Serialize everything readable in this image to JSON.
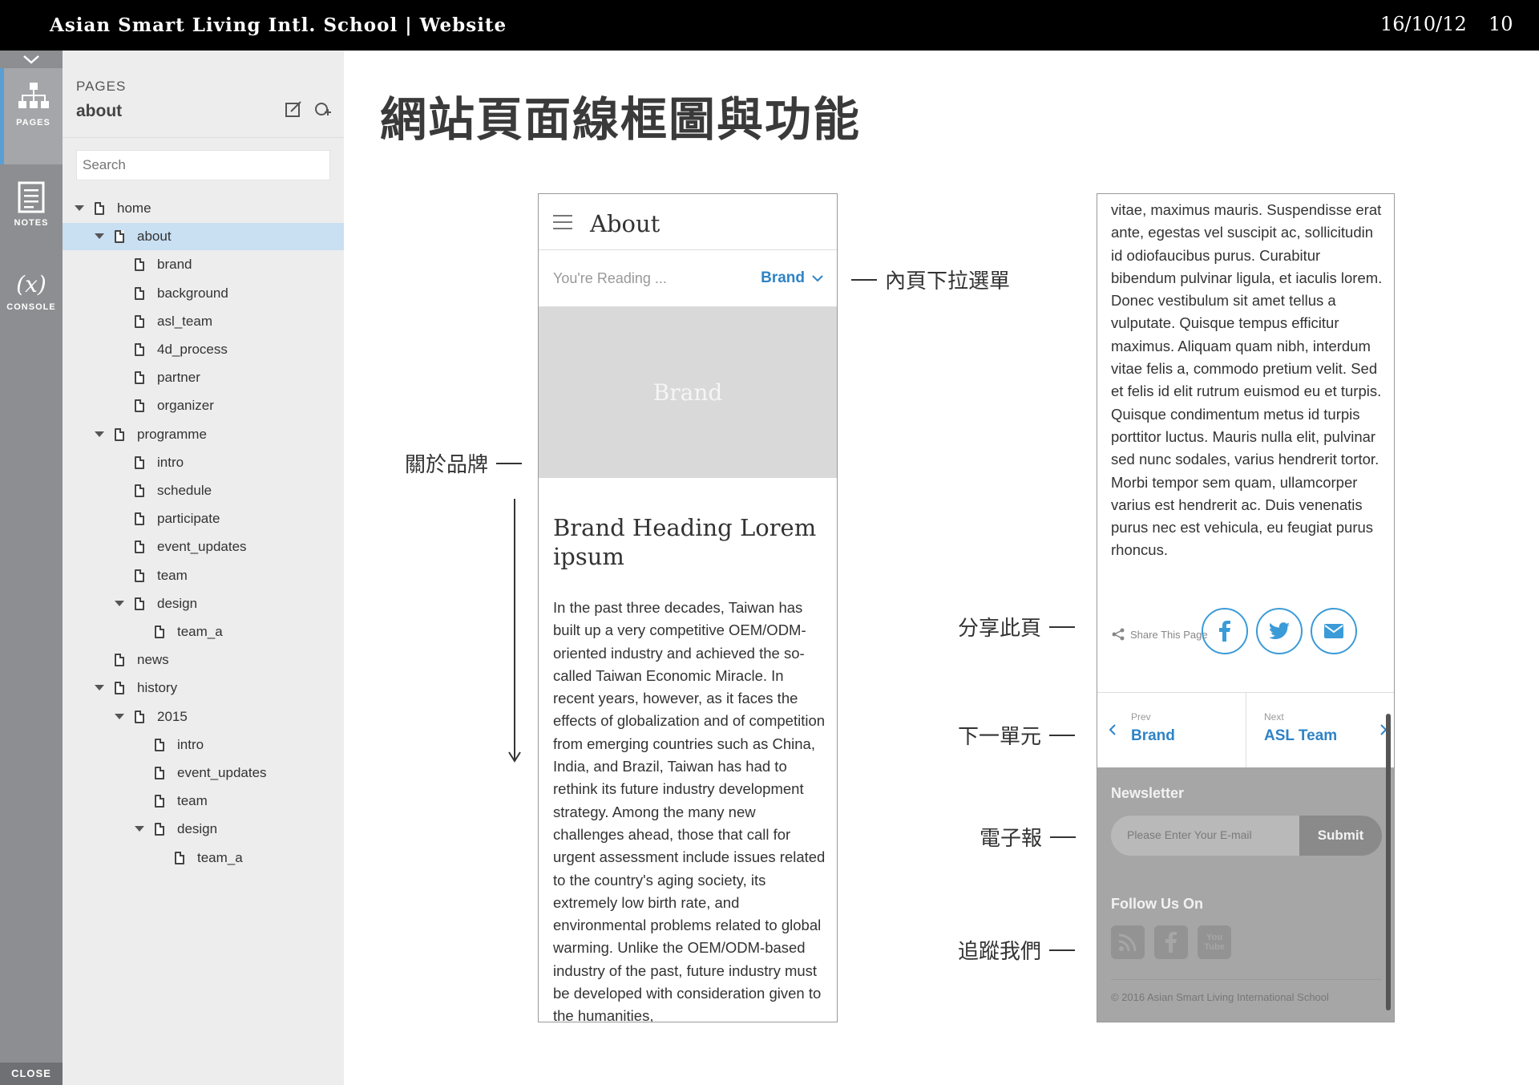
{
  "topbar": {
    "brand": "Asian Smart Living Intl. School | Website",
    "date": "16/10/12",
    "page_number": "10"
  },
  "rail": {
    "pages_label": "PAGES",
    "notes_label": "NOTES",
    "console_label": "CONSOLE",
    "console_symbol": "(x)",
    "close_label": "CLOSE"
  },
  "panel": {
    "heading": "PAGES",
    "current_page": "about",
    "search_placeholder": "Search",
    "tree": [
      {
        "label": "home",
        "depth": 0,
        "expanded": true,
        "selected": false
      },
      {
        "label": "about",
        "depth": 1,
        "expanded": true,
        "selected": true
      },
      {
        "label": "brand",
        "depth": 2
      },
      {
        "label": "background",
        "depth": 2
      },
      {
        "label": "asl_team",
        "depth": 2
      },
      {
        "label": "4d_process",
        "depth": 2
      },
      {
        "label": "partner",
        "depth": 2
      },
      {
        "label": "organizer",
        "depth": 2
      },
      {
        "label": "programme",
        "depth": 1,
        "expanded": true
      },
      {
        "label": "intro",
        "depth": 2
      },
      {
        "label": "schedule",
        "depth": 2
      },
      {
        "label": "participate",
        "depth": 2
      },
      {
        "label": "event_updates",
        "depth": 2
      },
      {
        "label": "team",
        "depth": 2
      },
      {
        "label": "design",
        "depth": 2,
        "expanded": true
      },
      {
        "label": "team_a",
        "depth": 3
      },
      {
        "label": "news",
        "depth": 1
      },
      {
        "label": "history",
        "depth": 1,
        "expanded": true
      },
      {
        "label": "2015",
        "depth": 2,
        "expanded": true
      },
      {
        "label": "intro",
        "depth": 3
      },
      {
        "label": "event_updates",
        "depth": 3
      },
      {
        "label": "team",
        "depth": 3
      },
      {
        "label": "design",
        "depth": 3,
        "expanded": true
      },
      {
        "label": "team_a",
        "depth": 4
      }
    ]
  },
  "slide": {
    "title": "網站頁面線框圖與功能",
    "annotations": {
      "dropdown": "內頁下拉選單",
      "brand": "關於品牌",
      "share": "分享此頁",
      "next_unit": "下一單元",
      "newsletter": "電子報",
      "follow": "追蹤我們"
    }
  },
  "phone1": {
    "header_title": "About",
    "reading_label": "You're Reading ...",
    "reading_value": "Brand",
    "hero_label": "Brand",
    "heading": "Brand Heading Lorem ipsum",
    "body": "In the past three decades, Taiwan has built up a very competitive OEM/ODM-oriented industry and achieved the so-called Taiwan Economic Miracle. In recent years, however, as it faces the effects of globalization and of competition from emerging countries such as China, India, and Brazil, Taiwan has had to rethink its future industry development strategy. Among the many new challenges ahead, those that call for urgent assessment include issues related to the country's aging society, its extremely low birth rate, and environmental problems related to global warming. Unlike the OEM/ODM-based industry of the past, future industry must be developed with consideration given to the humanities,"
  },
  "phone2": {
    "body": "vitae, maximus mauris. Suspendisse erat ante, egestas vel suscipit ac, sollicitudin id odiofaucibus purus. Curabitur bibendum pulvinar ligula, et iaculis lorem. Donec vestibulum sit amet tellus a vulputate. Quisque tempus efficitur maximus. Aliquam quam nibh, interdum vitae felis a, commodo pretium velit. Sed et felis id elit rutrum euismod eu et turpis. Quisque condimentum metus id turpis porttitor luctus. Mauris nulla elit, pulvinar sed nunc sodales, varius hendrerit tortor. Morbi tempor sem quam, ullamcorper varius est hendrerit ac. Duis venenatis purus nec est vehicula, eu feugiat purus rhoncus.",
    "share_label": "Share This Page",
    "prev_small": "Prev",
    "prev_title": "Brand",
    "next_small": "Next",
    "next_title": "ASL Team",
    "newsletter_title": "Newsletter",
    "email_placeholder": "Please Enter Your E-mail",
    "submit_label": "Submit",
    "follow_title": "Follow Us On",
    "youtube_text": "You Tube",
    "copyright": "© 2016 Asian Smart Living International School"
  },
  "colors": {
    "accent": "#2e83c6",
    "social_ring": "#3a9bd8",
    "selection": "#c9dff2",
    "rail": "#8d8e91",
    "footer": "#a6a6a6"
  }
}
